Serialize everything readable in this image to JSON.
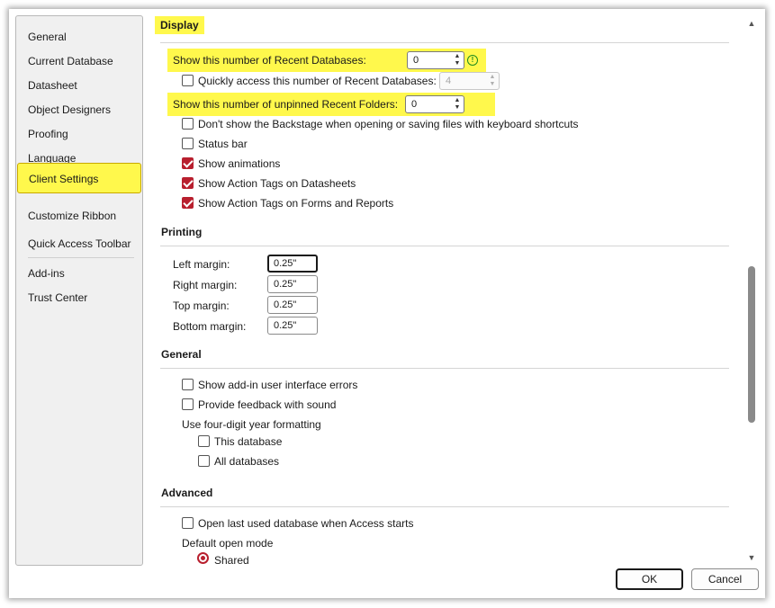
{
  "sidebar": {
    "items": [
      {
        "label": "General"
      },
      {
        "label": "Current Database"
      },
      {
        "label": "Datasheet"
      },
      {
        "label": "Object Designers"
      },
      {
        "label": "Proofing"
      },
      {
        "label": "Language"
      },
      {
        "label": "Client Settings"
      },
      {
        "label": "Customize Ribbon"
      },
      {
        "label": "Quick Access Toolbar"
      },
      {
        "label": "Add-ins"
      },
      {
        "label": "Trust Center"
      }
    ],
    "active": "Client Settings"
  },
  "display": {
    "title": "Display",
    "recent_databases_label": "Show this number of Recent Databases:",
    "recent_databases_value": "0",
    "quick_access_label": "Quickly access this number of Recent Databases:",
    "quick_access_value": "4",
    "quick_access_checked": false,
    "recent_folders_label": "Show this number of unpinned Recent Folders:",
    "recent_folders_value": "0",
    "backstage_label": "Don't show the Backstage when opening or saving files with keyboard shortcuts",
    "status_bar_label": "Status bar",
    "animations_label": "Show animations",
    "action_tags_datasheets_label": "Show Action Tags on Datasheets",
    "action_tags_forms_label": "Show Action Tags on Forms and Reports"
  },
  "printing": {
    "title": "Printing",
    "left_label": "Left margin:",
    "left_value": "0.25\"",
    "right_label": "Right margin:",
    "right_value": "0.25\"",
    "top_label": "Top margin:",
    "top_value": "0.25\"",
    "bottom_label": "Bottom margin:",
    "bottom_value": "0.25\""
  },
  "general": {
    "title": "General",
    "addin_errors_label": "Show add-in user interface errors",
    "feedback_sound_label": "Provide feedback with sound",
    "year_format_label": "Use four-digit year formatting",
    "this_database_label": "This database",
    "all_databases_label": "All databases"
  },
  "advanced": {
    "title": "Advanced",
    "open_last_label": "Open last used database when Access starts",
    "default_open_mode_label": "Default open mode",
    "shared_label": "Shared"
  },
  "buttons": {
    "ok": "OK",
    "cancel": "Cancel"
  },
  "colors": {
    "highlight": "#fff84c",
    "accent": "#b81f2e",
    "info": "#1e8c1e"
  }
}
